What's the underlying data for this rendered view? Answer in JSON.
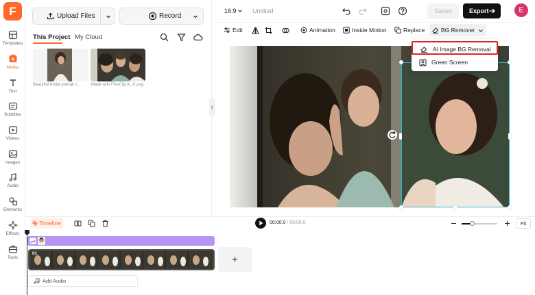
{
  "app": {
    "logo_letter": "F",
    "brand_color": "#ff6a2b"
  },
  "nav": {
    "items": [
      {
        "id": "templates",
        "label": "Templates",
        "icon": "templates-icon"
      },
      {
        "id": "media",
        "label": "Media",
        "icon": "media-icon",
        "active": true
      },
      {
        "id": "text",
        "label": "Text",
        "icon": "text-icon"
      },
      {
        "id": "subtitles",
        "label": "Subtitles",
        "icon": "subtitles-icon"
      },
      {
        "id": "videos",
        "label": "Videos",
        "icon": "videos-icon"
      },
      {
        "id": "images",
        "label": "Images",
        "icon": "images-icon"
      },
      {
        "id": "audio",
        "label": "Audio",
        "icon": "audio-icon"
      },
      {
        "id": "elements",
        "label": "Elements",
        "icon": "elements-icon"
      },
      {
        "id": "effects",
        "label": "Effects",
        "icon": "effects-icon"
      },
      {
        "id": "tools",
        "label": "Tools",
        "icon": "tools-icon"
      }
    ]
  },
  "media": {
    "upload_label": "Upload Files",
    "record_label": "Record",
    "tabs": [
      {
        "label": "This Project",
        "active": true
      },
      {
        "label": "My Cloud",
        "active": false
      }
    ],
    "files": [
      {
        "caption": "Beautiful bridal portrait s..."
      },
      {
        "caption": "Made with FlexClip A...0.png"
      }
    ]
  },
  "topbar": {
    "ratio": "16:9",
    "project_title": "Untitled",
    "saved_label": "Saved",
    "export_label": "Export",
    "avatar_letter": "E",
    "avatar_color": "#d6336c"
  },
  "edit_toolbar": {
    "edit": "Edit",
    "animation": "Animation",
    "inside_motion": "Inside Motion",
    "replace": "Replace",
    "bg_remover": "BG Remover"
  },
  "bg_menu": {
    "items": [
      {
        "label": "AI Image BG Removal",
        "highlighted": true
      },
      {
        "label": "Green Screen",
        "highlighted": false
      }
    ],
    "highlight_color": "#d9252a"
  },
  "timeline": {
    "tab_label": "Timeline",
    "current_time": "00:00.0",
    "separator": "/",
    "duration": "00:05.0",
    "fit_label": "Fit",
    "zoom_level": 0.3,
    "clip_number": "01",
    "add_audio_label": "Add Audio",
    "add_clip_symbol": "+"
  }
}
